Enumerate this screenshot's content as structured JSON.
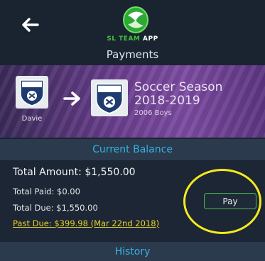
{
  "header": {
    "logo_text_green": "SL TEAM",
    "logo_text_white": " APP",
    "title": "Payments"
  },
  "banner": {
    "from_team": "Davie",
    "season_title_line1": "Soccer Season",
    "season_title_line2": "2018-2019",
    "season_subtitle": "2006 Boys"
  },
  "current_balance": {
    "label": "Current Balance",
    "total_amount": "Total Amount: $1,550.00",
    "total_paid": "Total Paid: $0.00",
    "total_due": "Total Due: $1,550.00",
    "past_due": "Past Due: $399.98 (Mar 22nd 2018)",
    "pay_label": "Pay"
  },
  "history": {
    "label": "History"
  },
  "colors": {
    "accent_blue": "#33b3e0",
    "pay_border_green": "#49b84d",
    "past_due_yellow": "#e8d22a",
    "highlight_yellow": "#f4ea1c",
    "banner_purple": "#6a3e8e"
  },
  "icons": {
    "back": "back-arrow-icon",
    "logo": "sl-team-app-logo-icon",
    "transfer": "right-arrow-icon",
    "team_badge": "davie-team-crest-icon"
  }
}
